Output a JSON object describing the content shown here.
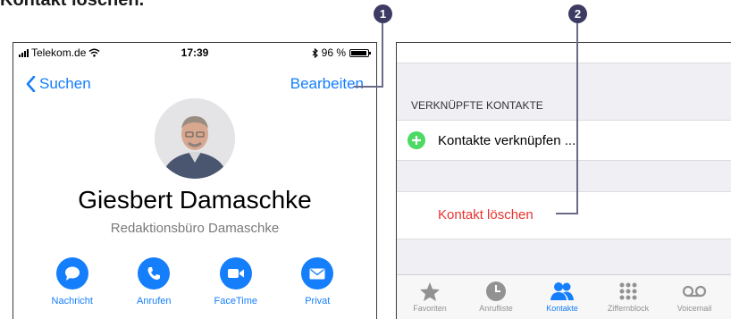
{
  "heading": "Kontakt löschen.",
  "callouts": [
    "1",
    "2"
  ],
  "left_screen": {
    "status": {
      "carrier": "Telekom.de",
      "time": "17:39",
      "battery": "96 %"
    },
    "nav": {
      "back": "Suchen",
      "edit": "Bearbeiten"
    },
    "contact": {
      "name": "Giesbert Damaschke",
      "company": "Redaktionsbüro Damaschke"
    },
    "actions": [
      {
        "label": "Nachricht",
        "icon": "message-icon"
      },
      {
        "label": "Anrufen",
        "icon": "phone-icon"
      },
      {
        "label": "FaceTime",
        "icon": "video-icon"
      },
      {
        "label": "Privat",
        "icon": "mail-icon"
      }
    ]
  },
  "right_screen": {
    "section_header": "VERKNÜPFTE KONTAKTE",
    "link_contacts": "Kontakte verknüpfen ...",
    "delete_contact": "Kontakt löschen",
    "tabs": [
      {
        "label": "Favoriten",
        "icon": "star-icon",
        "active": false
      },
      {
        "label": "Anrufliste",
        "icon": "clock-icon",
        "active": false
      },
      {
        "label": "Kontakte",
        "icon": "contacts-icon",
        "active": true
      },
      {
        "label": "Ziffernblock",
        "icon": "keypad-icon",
        "active": false
      },
      {
        "label": "Voicemail",
        "icon": "voicemail-icon",
        "active": false
      }
    ]
  },
  "colors": {
    "accent": "#147efb",
    "destructive": "#e8332f",
    "add": "#4cd964",
    "callout": "#3d3b63"
  }
}
